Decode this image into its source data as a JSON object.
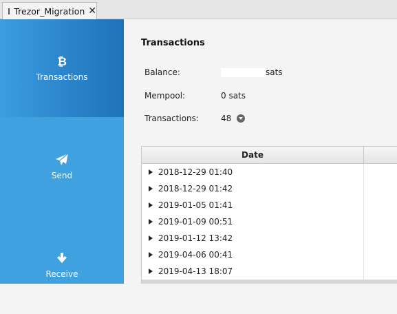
{
  "window": {
    "tab_title": "Trezor_Migration",
    "tab_icon": "wallet-icon",
    "close_icon": "close-icon"
  },
  "sidebar": {
    "accent_color": "#3fa1e0",
    "active_color": "#1f72b8",
    "items": [
      {
        "label": "Transactions",
        "icon": "bitcoin-icon",
        "active": true
      },
      {
        "label": "Send",
        "icon": "paper-plane-icon",
        "active": false
      },
      {
        "label": "Receive",
        "icon": "arrow-down-icon",
        "active": false
      }
    ]
  },
  "main": {
    "title": "Transactions",
    "balance": {
      "label": "Balance:",
      "value_redacted": true,
      "unit": "sats"
    },
    "mempool": {
      "label": "Mempool:",
      "value": "0 sats"
    },
    "transactions": {
      "label": "Transactions:",
      "value": "48",
      "icon": "download-circle-icon"
    }
  },
  "table": {
    "columns": [
      "Date"
    ],
    "rows": [
      "2018-12-29 01:40",
      "2018-12-29 01:42",
      "2019-01-05 01:41",
      "2019-01-09 00:51",
      "2019-01-12 13:42",
      "2019-04-06 00:41",
      "2019-04-13 18:07"
    ]
  }
}
